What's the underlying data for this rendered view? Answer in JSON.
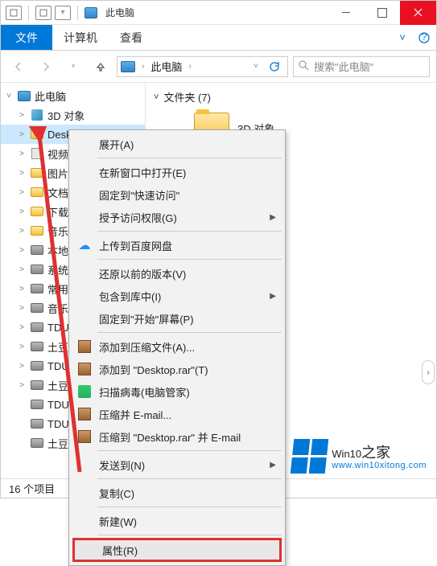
{
  "titlebar": {
    "title": "此电脑"
  },
  "ribbon": {
    "file": "文件",
    "tabs": [
      "计算机",
      "查看"
    ]
  },
  "address": {
    "location": "此电脑",
    "search_placeholder": "搜索\"此电脑\""
  },
  "tree": {
    "root": "此电脑",
    "items": [
      {
        "label": "3D 对象",
        "icon": "3d",
        "tw": ">"
      },
      {
        "label": "Desktop",
        "icon": "folder",
        "tw": ">",
        "cut": true,
        "sel": true
      },
      {
        "label": "视频",
        "icon": "vid",
        "tw": ">"
      },
      {
        "label": "图片",
        "icon": "folder",
        "tw": ">"
      },
      {
        "label": "文档",
        "icon": "folder",
        "tw": ">"
      },
      {
        "label": "下载",
        "icon": "folder",
        "tw": ">"
      },
      {
        "label": "音乐",
        "icon": "folder",
        "tw": ">"
      },
      {
        "label": "本地",
        "icon": "drive",
        "tw": ">"
      },
      {
        "label": "系统",
        "icon": "drive",
        "tw": ">"
      },
      {
        "label": "常用",
        "icon": "drive",
        "tw": ">"
      },
      {
        "label": "音乐",
        "icon": "drive",
        "tw": ">"
      },
      {
        "label": "TDU",
        "icon": "drive",
        "tw": ">"
      },
      {
        "label": "土豆",
        "icon": "drive",
        "tw": ">"
      },
      {
        "label": "TDU",
        "icon": "drive",
        "tw": ">"
      },
      {
        "label": "土豆",
        "icon": "drive",
        "tw": ">"
      },
      {
        "label": "TDUP",
        "icon": "drive",
        "tw": ""
      },
      {
        "label": "TDUP",
        "icon": "drive",
        "tw": ""
      },
      {
        "label": "土豆U",
        "icon": "drive",
        "tw": ""
      }
    ]
  },
  "content": {
    "group_label": "文件夹 (7)",
    "item_label": "3D 对象"
  },
  "contextmenu": {
    "items": [
      {
        "label": "展开(A)",
        "sep_after": true
      },
      {
        "label": "在新窗口中打开(E)"
      },
      {
        "label": "固定到\"快速访问\""
      },
      {
        "label": "授予访问权限(G)",
        "sub": true,
        "sep_after": true
      },
      {
        "label": "上传到百度网盘",
        "icon": "cloud",
        "sep_after": true
      },
      {
        "label": "还原以前的版本(V)"
      },
      {
        "label": "包含到库中(I)",
        "sub": true
      },
      {
        "label": "固定到\"开始\"屏幕(P)",
        "sep_after": true
      },
      {
        "label": "添加到压缩文件(A)...",
        "icon": "rar"
      },
      {
        "label": "添加到 \"Desktop.rar\"(T)",
        "icon": "rar"
      },
      {
        "label": "扫描病毒(电脑管家)",
        "icon": "shield"
      },
      {
        "label": "压缩并 E-mail...",
        "icon": "rar"
      },
      {
        "label": "压缩到 \"Desktop.rar\" 并 E-mail",
        "icon": "rar",
        "sep_after": true
      },
      {
        "label": "发送到(N)",
        "sub": true,
        "sep_after": true
      },
      {
        "label": "复制(C)",
        "sep_after": true
      },
      {
        "label": "新建(W)",
        "sep_after": true
      },
      {
        "label": "属性(R)",
        "highlight": true
      }
    ]
  },
  "status": {
    "text": "16 个项目"
  },
  "watermark": {
    "brand": "Win10",
    "suffix": "之家",
    "url": "www.win10xitong.com"
  }
}
